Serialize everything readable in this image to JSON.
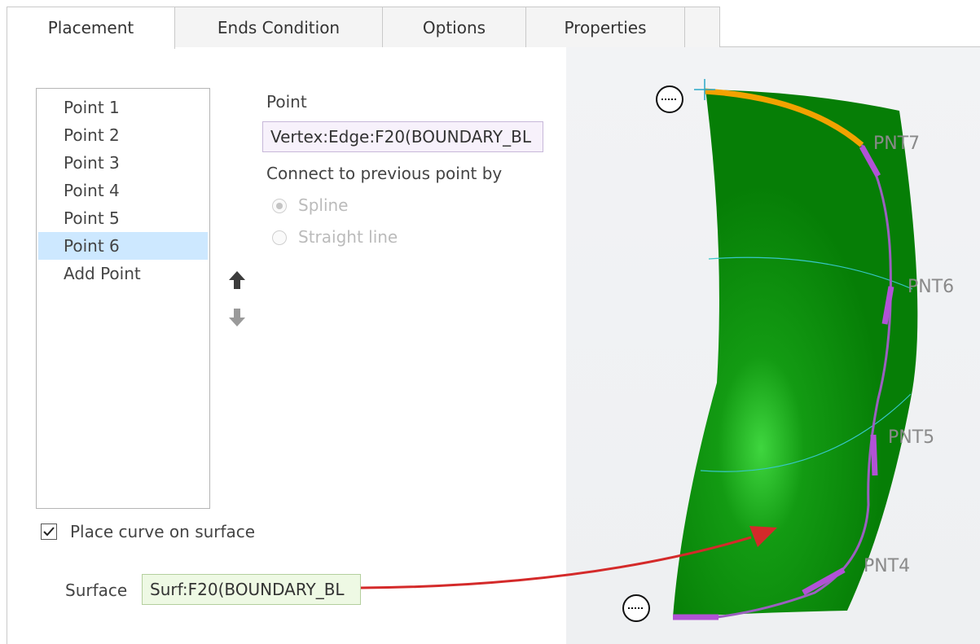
{
  "tabs": [
    {
      "label": "Placement",
      "active": true
    },
    {
      "label": "Ends Condition",
      "active": false
    },
    {
      "label": "Options",
      "active": false
    },
    {
      "label": "Properties",
      "active": false
    }
  ],
  "points_list": [
    "Point 1",
    "Point 2",
    "Point 3",
    "Point 4",
    "Point 5",
    "Point 6",
    "Add Point"
  ],
  "selected_point": "Point 6",
  "point_section": {
    "label": "Point",
    "value": "Vertex:Edge:F20(BOUNDARY_BL",
    "connect_label": "Connect to previous point by",
    "options": [
      "Spline",
      "Straight line"
    ],
    "selected_option": "Spline"
  },
  "place_on_surface": {
    "label": "Place curve on surface",
    "checked": true
  },
  "surface": {
    "label": "Surface",
    "value": "Surf:F20(BOUNDARY_BL"
  },
  "viewport": {
    "point_labels": [
      "PNT7",
      "PNT6",
      "PNT5",
      "PNT4"
    ],
    "surface_color": "#0a8a0a",
    "curve_color": "#9b5fc0",
    "edge_highlight_color": "#f2a200",
    "arrow_color": "#d42a2a"
  },
  "icons": {
    "move_up": "arrow-up-icon",
    "move_down": "arrow-down-icon"
  }
}
